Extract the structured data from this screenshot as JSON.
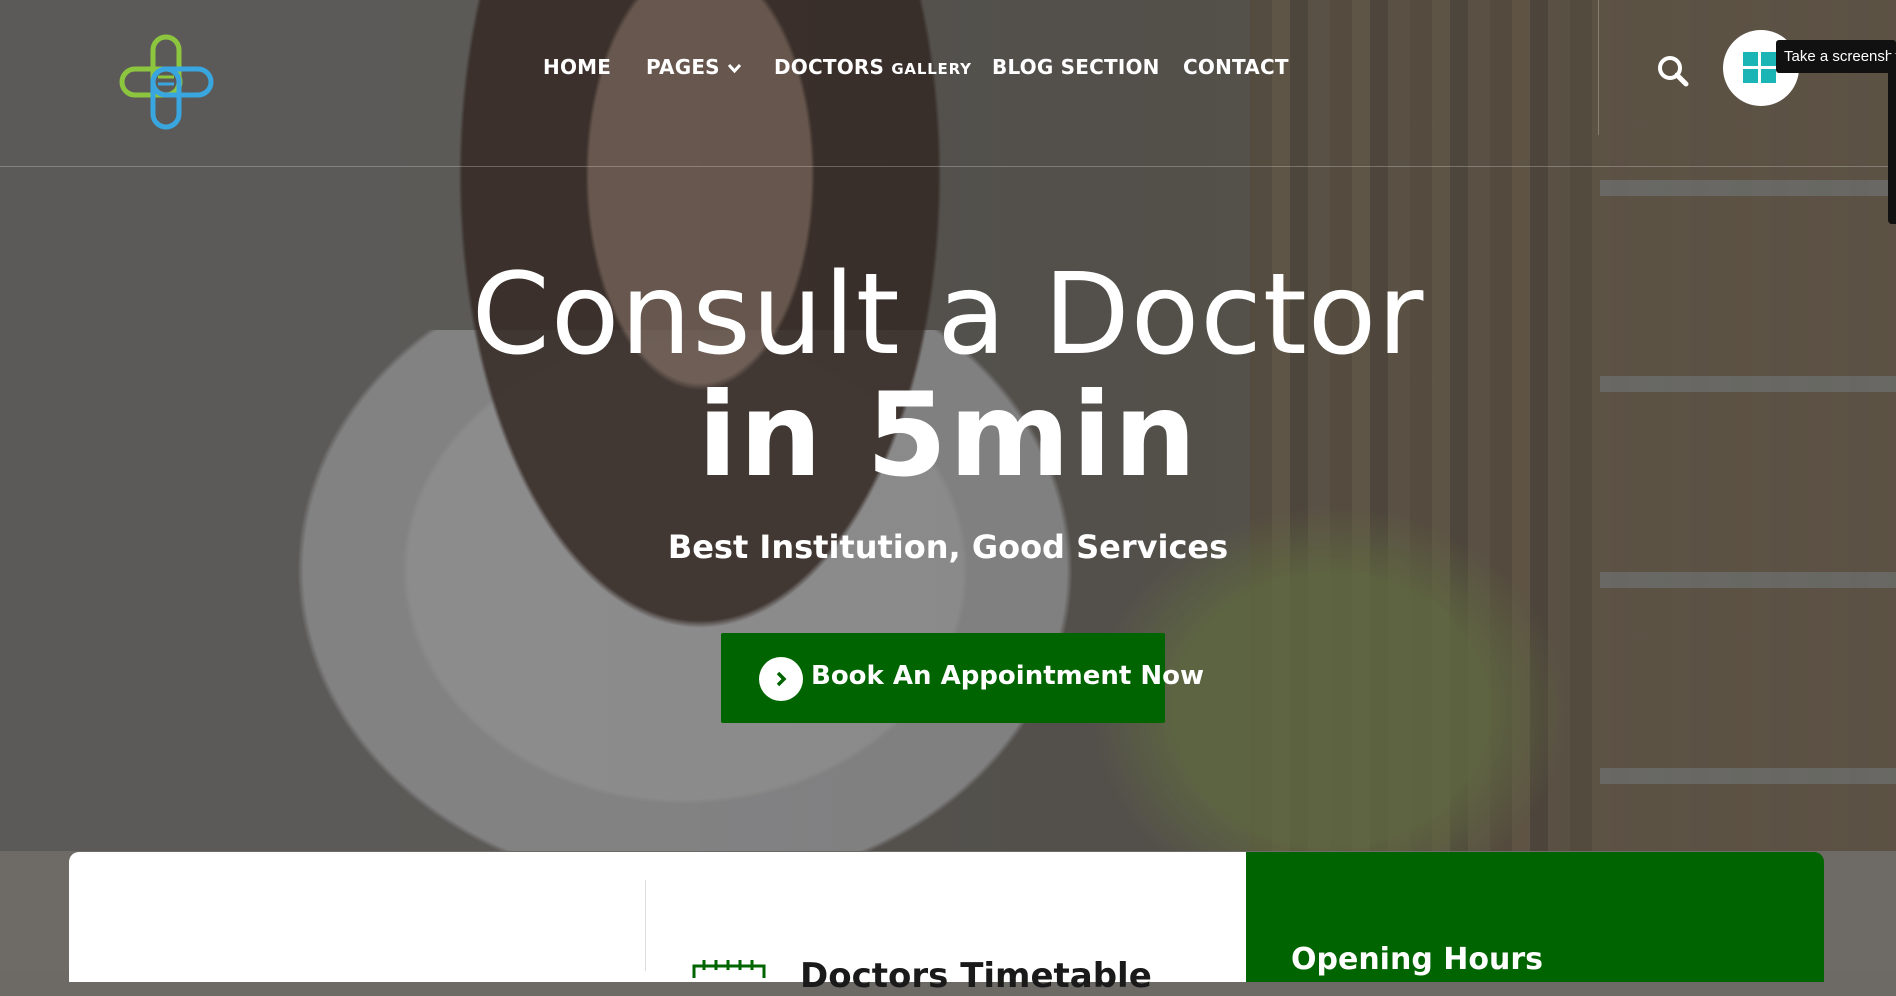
{
  "nav": {
    "items": [
      {
        "label": "HOME"
      },
      {
        "label": "PAGES"
      },
      {
        "label_main": "DOCTORS",
        "label_small": "GALLERY"
      },
      {
        "label": "BLOG SECTION"
      },
      {
        "label": "CONTACT"
      }
    ]
  },
  "tooltip": "Take a screenshot",
  "hero": {
    "title_line1": "Consult a Doctor",
    "title_line2": "in 5min",
    "subtitle": "Best Institution, Good Services",
    "cta_label": "Book An Appointment Now"
  },
  "info": {
    "doctors_timetable": "Doctors Timetable",
    "opening_hours": "Opening Hours"
  },
  "colors": {
    "primary_green": "#006400",
    "logo_green": "#8cc63f",
    "logo_blue": "#3aa6e0",
    "app_teal": "#1bb5b5"
  }
}
